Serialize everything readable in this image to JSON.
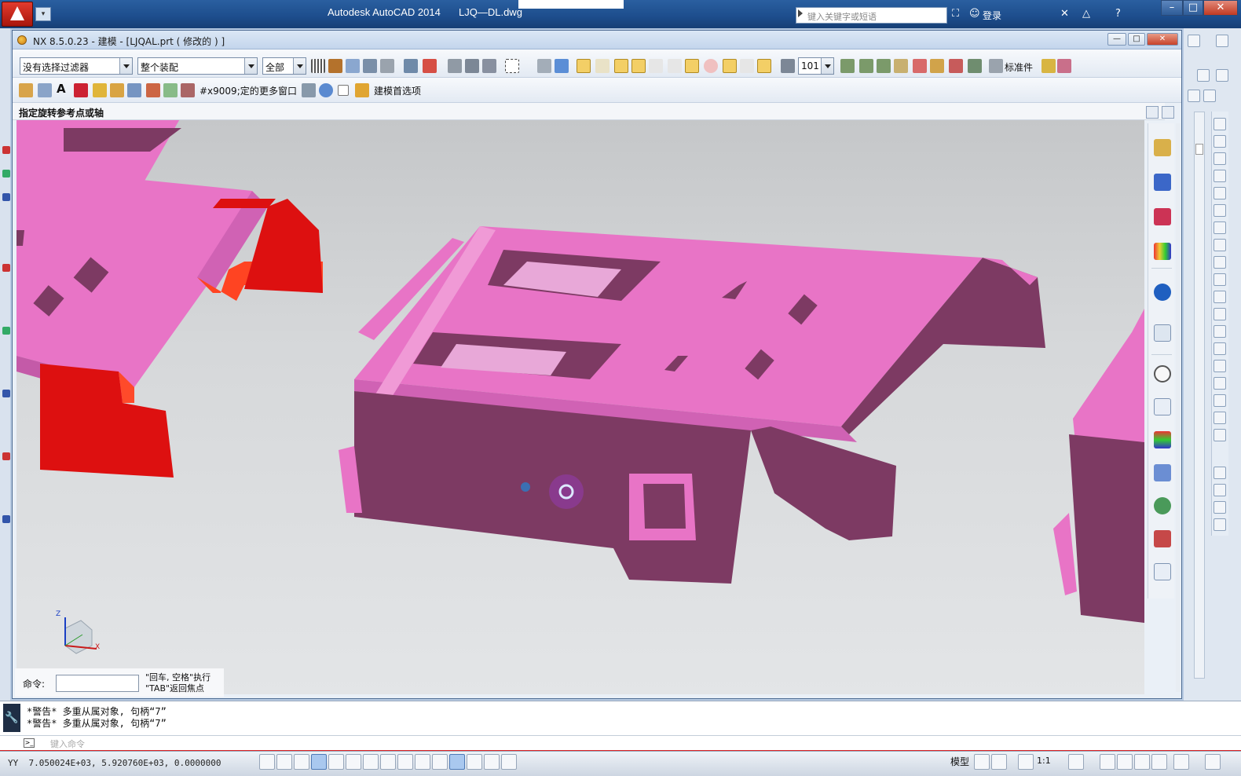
{
  "autocad": {
    "app_title": "Autodesk AutoCAD 2014",
    "file_name": "LJQ—DL.dwg",
    "search_placeholder": "键入关键字或短语",
    "login_label": "登录",
    "command_history": [
      "*警告* 多重从属对象, 句柄“7”",
      "*警告* 多重从属对象, 句柄“7”"
    ],
    "command_placeholder": "键入命令",
    "coordinates": "7.050024E+03, 5.920760E+03, 0.0000000",
    "status_model": "模型",
    "annotation_scale": "1:1",
    "coords_prefix": "YY"
  },
  "nx": {
    "window_title": "NX 8.5.0.23 - 建模 - [LJQAL.prt ( 修改的 ) ]",
    "selection_filter": "没有选择过滤器",
    "scope": "整个装配",
    "layer_filter": "全部",
    "work_layer": "101",
    "standard_parts_label": "标准件",
    "toolbar2_text_1": "#x9009;定的",
    "toolbar2_text_2": "更多窗口",
    "toolbar2_text_3": "建模首选项",
    "cue_line": "指定旋转参考点或轴",
    "command_label": "命令:",
    "command_hint_1": "\"回车, 空格\"执行",
    "command_hint_2": "\"TAB\"返回焦点",
    "triad": {
      "z": "Z",
      "x": "X"
    }
  },
  "colors": {
    "part_pink": "#e874c6",
    "part_shade": "#7d3a63",
    "selected_red": "#dd1010"
  }
}
